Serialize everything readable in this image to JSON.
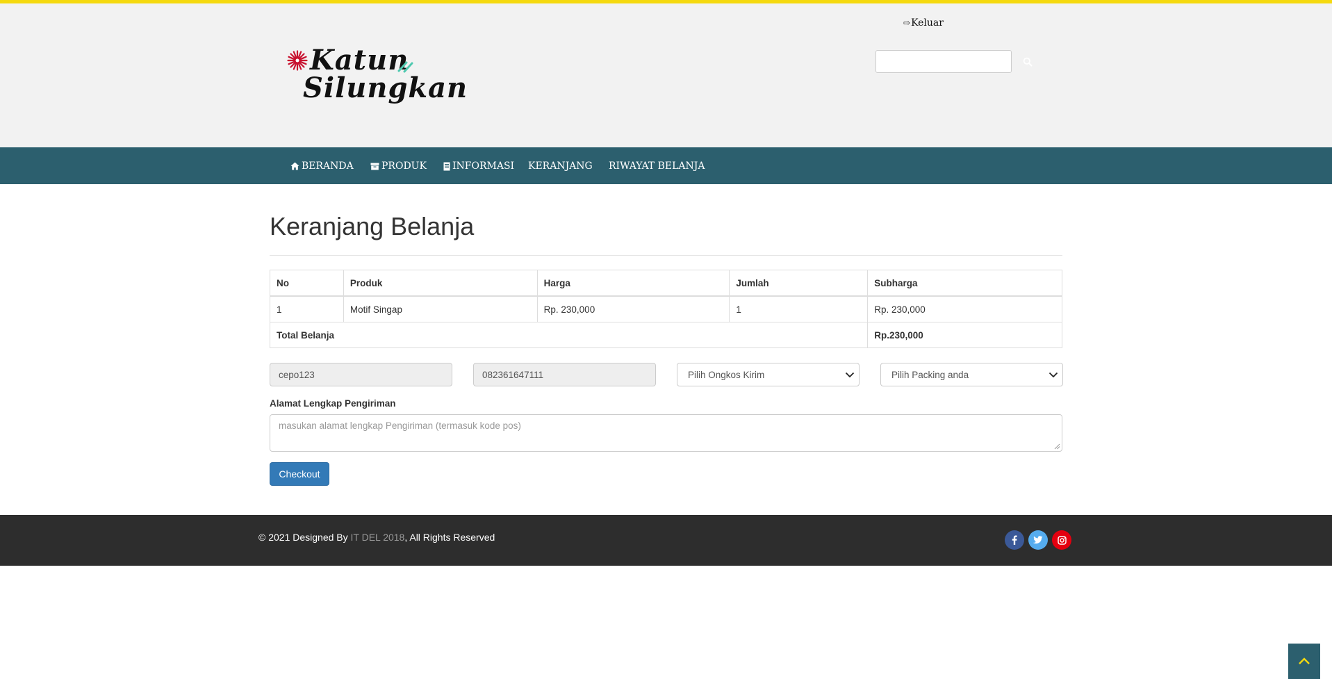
{
  "header": {
    "brand_line1": "Katun",
    "brand_line2": "Silungkan",
    "logout_label": "Keluar",
    "search": {
      "value": "",
      "placeholder": ""
    }
  },
  "nav": {
    "items": [
      {
        "label": "BERANDA",
        "icon": "home-icon"
      },
      {
        "label": "PRODUK",
        "icon": "archive-icon"
      },
      {
        "label": "INFORMASI",
        "icon": "document-icon"
      },
      {
        "label": "KERANJANG",
        "icon": ""
      },
      {
        "label": "RIWAYAT BELANJA",
        "icon": ""
      }
    ]
  },
  "cart": {
    "title": "Keranjang Belanja",
    "columns": [
      "No",
      "Produk",
      "Harga",
      "Jumlah",
      "Subharga"
    ],
    "rows": [
      {
        "no": "1",
        "produk": "Motif Singap",
        "harga": "Rp. 230,000",
        "jumlah": "1",
        "subharga": "Rp. 230,000"
      }
    ],
    "total_label": "Total Belanja",
    "total_value": "Rp.230,000"
  },
  "form": {
    "username": "cepo123",
    "phone": "082361647111",
    "shipping_select": "Pilih Ongkos Kirim",
    "packing_select": "Pilih Packing anda",
    "address_label": "Alamat Lengkap Pengiriman",
    "address_placeholder": "masukan alamat lengkap Pengiriman (termasuk kode pos)",
    "checkout_label": "Checkout"
  },
  "footer": {
    "copyright_prefix": "© 2021 Designed By ",
    "credit": "IT DEL 2018",
    "copyright_suffix": ", All Rights Reserved",
    "social": [
      "facebook-icon",
      "twitter-icon",
      "instagram-icon"
    ]
  },
  "colors": {
    "accent_yellow": "#f5d90f",
    "navbar": "#2c5f6e",
    "checkout_button": "#337ab7",
    "footer": "#2d2d2d",
    "facebook": "#3b5998",
    "twitter": "#55acee",
    "instagram": "#e4000f"
  }
}
